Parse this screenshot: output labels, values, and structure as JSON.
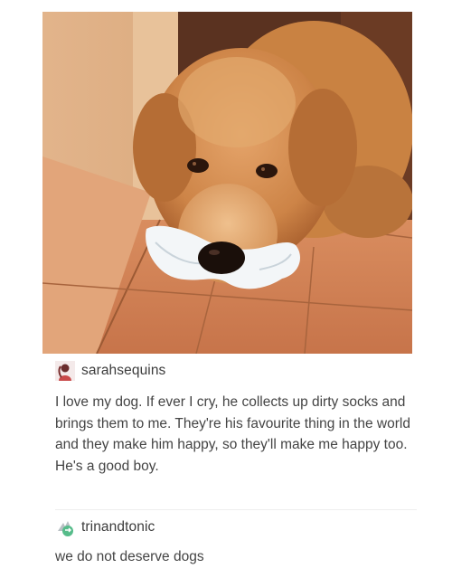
{
  "post_image": {
    "subject": "dog-with-sock"
  },
  "posts": [
    {
      "username": "sarahsequins",
      "text": "I love my dog. If ever I cry, he collects up dirty socks and brings them to me. They're his favourite thing in the world and they make him happy, so they'll make me happy too. He's a good boy.",
      "avatar_icon": "user-avatar-icon"
    },
    {
      "username": "trinandtonic",
      "text": "we do not deserve dogs",
      "avatar_icon": "reblog-avatar-icon",
      "badge_color": "#56bc8a"
    }
  ]
}
